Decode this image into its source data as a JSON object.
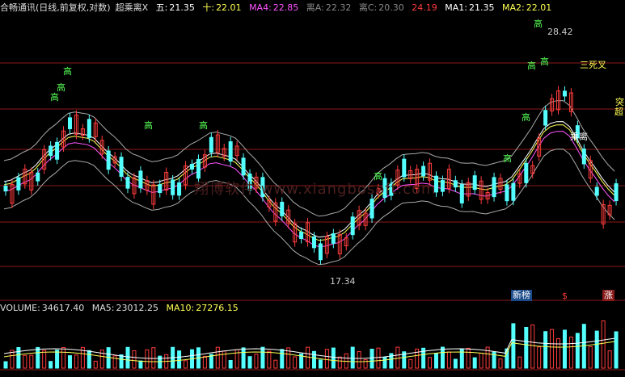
{
  "top_legend": {
    "title": "合畅通讯(日线,前复权,对数)",
    "indicator": "超乘离X",
    "wu_label": "五:",
    "wu_value": "21.35",
    "shi_label": "十:",
    "shi_value": "22.01",
    "ma4_label": "MA4:",
    "ma4_value": "22.85",
    "lia_label": "离A:",
    "lia_value": "22.32",
    "lic_label": "离C:",
    "lic_value": "20.30",
    "extra_value": "24.19",
    "ma1_label": "MA1:",
    "ma1_value": "21.35",
    "ma2_label": "MA2:",
    "ma2_value": "22.01"
  },
  "vol_legend": {
    "volume_label": "VOLUME:",
    "volume_value": "34617.40",
    "ma5_label": "MA5:",
    "ma5_value": "23012.25",
    "ma10_label": "MA10:",
    "ma10_value": "27276.15"
  },
  "price_labels": {
    "high": "28.42",
    "low": "17.34"
  },
  "markers": {
    "gao": "高",
    "san_si_cha": "三死叉",
    "chao_cheng_li": "乘离",
    "xin_bang": "新榜",
    "zhang": "涨",
    "chao": "超",
    "tu": "突"
  },
  "watermark": "翔博软件 www.xiangbosoft.com",
  "colors": {
    "background": "#000000",
    "up": "#ff3c3c",
    "down": "#54ffff",
    "ma_yellow": "#ffff54",
    "ma_magenta": "#ff54ff",
    "band": "#aaaaaa",
    "gridline": "#8b1a1a"
  }
}
